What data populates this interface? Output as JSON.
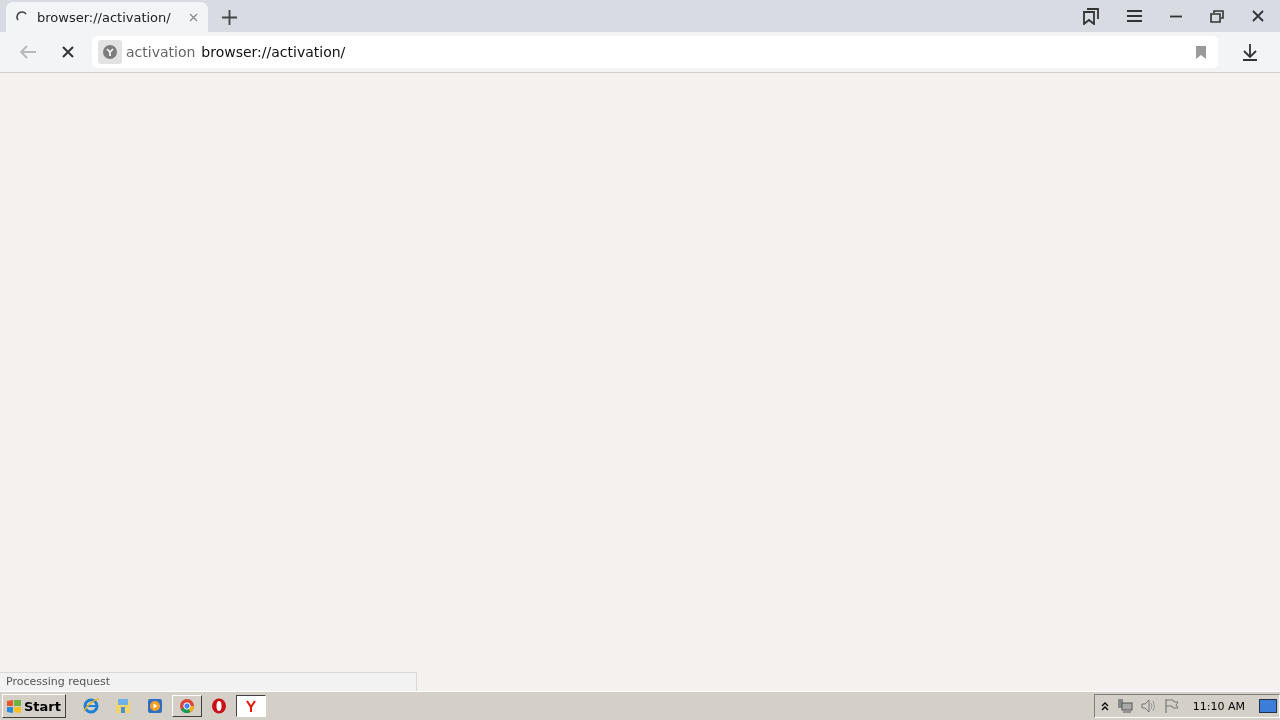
{
  "tabs": [
    {
      "title": "browser://activation/",
      "selected": true,
      "loading": true
    }
  ],
  "address_bar": {
    "site_name": "activation",
    "url": "browser://activation/"
  },
  "status_bar": {
    "text": "Processing request"
  },
  "taskbar": {
    "start": "Start",
    "apps": [
      {
        "kind": "ie",
        "open": false,
        "selected": false
      },
      {
        "kind": "explorer",
        "open": false,
        "selected": false
      },
      {
        "kind": "media",
        "open": false,
        "selected": false
      },
      {
        "kind": "chrome",
        "open": true,
        "selected": false
      },
      {
        "kind": "opera",
        "open": false,
        "selected": false
      },
      {
        "kind": "yandex",
        "open": true,
        "selected": true
      }
    ],
    "clock": "11:10 AM"
  }
}
